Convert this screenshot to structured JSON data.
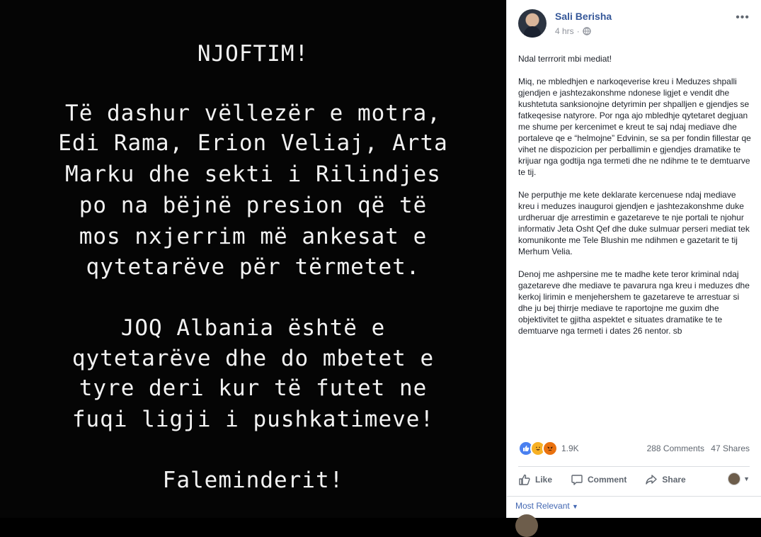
{
  "image": {
    "lines": [
      "NJOFTIM!",
      "Të dashur vëllezër e motra,",
      "Edi Rama, Erion Veliaj, Arta",
      "Marku dhe sekti i Rilindjes",
      "po na bëjnë presion që të",
      "mos nxjerrim më ankesat e",
      "qytetarëve për tërmetet.",
      "JOQ Albania është e",
      "qytetarëve dhe do mbetet e",
      "tyre deri kur të futet ne",
      "fuqi ligji i pushkatimeve!",
      "Faleminderit!"
    ]
  },
  "post": {
    "author": "Sali Berisha",
    "time": "4 hrs",
    "privacy_icon": "globe-icon",
    "more_icon": "more-options-icon",
    "paragraphs": [
      "Ndal terrrorit mbi mediat!",
      "Miq, ne mbledhjen e narkoqeverise kreu i Meduzes shpalli gjendjen e jashtezakonshme ndonese ligjet e vendit dhe kushtetuta sanksionojne detyrimin per shpalljen e gjendjes se fatkeqesise natyrore. Por nga ajo mbledhje qytetaret degjuan me shume per kercenimet e kreut te saj ndaj mediave dhe portaleve qe e “helmojne” Edvinin, se sa per fondin fillestar qe vihet ne dispozicion per perballimin e gjendjes dramatike te krijuar nga godtija nga termeti dhe ne ndihme te te demtuarve te tij.",
      "Ne perputhje me kete deklarate kercenuese ndaj mediave kreu i meduzes inauguroi gjendjen e jashtezakonshme duke urdheruar dje arrestimin e gazetareve te nje portali te njohur informativ Jeta Osht Qef dhe duke sulmuar perseri mediat tek komunikonte me Tele Blushin me ndihmen e gazetarit te tij Merhum Velia.",
      "Denoj me ashpersine me te madhe kete teror kriminal ndaj gazetareve dhe mediave te pavarura nga kreu i meduzes dhe kerkoj lirimin e menjehershem te gazetareve te arrestuar si dhe ju bej thirrje mediave te raportojne me guxim dhe objektivitet te gjitha aspektet e situates dramatike te te demtuarve nga termeti i dates 26 nentor. sb"
    ]
  },
  "engagement": {
    "reaction_count": "1.9K",
    "comments": "288 Comments",
    "shares": "47 Shares",
    "reaction_icons": [
      "like-icon",
      "haha-icon",
      "angry-icon"
    ]
  },
  "actions": {
    "like": "Like",
    "comment": "Comment",
    "share": "Share"
  },
  "comments": {
    "filter_label": "Most Relevant"
  },
  "colors": {
    "link": "#365899",
    "meta": "#90949c",
    "text": "#1d2129",
    "image_background": "#050505"
  }
}
